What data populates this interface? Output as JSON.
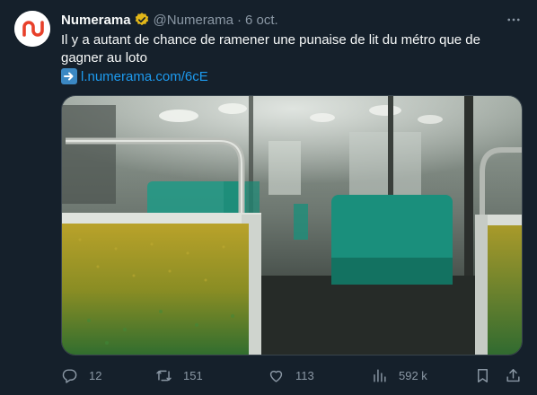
{
  "account": {
    "name": "Numerama",
    "handle": "@Numerama",
    "separator": "·",
    "date": "6 oct."
  },
  "tweet": {
    "text": "Il y a autant de chance de ramener une punaise de lit du métro que de gagner au loto",
    "link": "l.numerama.com/6cE"
  },
  "actions": {
    "replies": "12",
    "retweets": "151",
    "likes": "113",
    "views": "592 k"
  },
  "colors": {
    "background": "#15202b",
    "text_primary": "#f7f9f9",
    "text_secondary": "#8b98a5",
    "link": "#1d9bf0",
    "verified_badge": "#e2b719",
    "avatar_logo": "#e8402a"
  },
  "icons": {
    "more": "more-horizontal-icon",
    "verified": "verified-badge-icon",
    "link_arrow": "right-arrow-emoji-icon",
    "reply": "reply-icon",
    "retweet": "retweet-icon",
    "like": "heart-icon",
    "views": "views-bar-chart-icon",
    "bookmark": "bookmark-icon",
    "share": "share-icon"
  }
}
